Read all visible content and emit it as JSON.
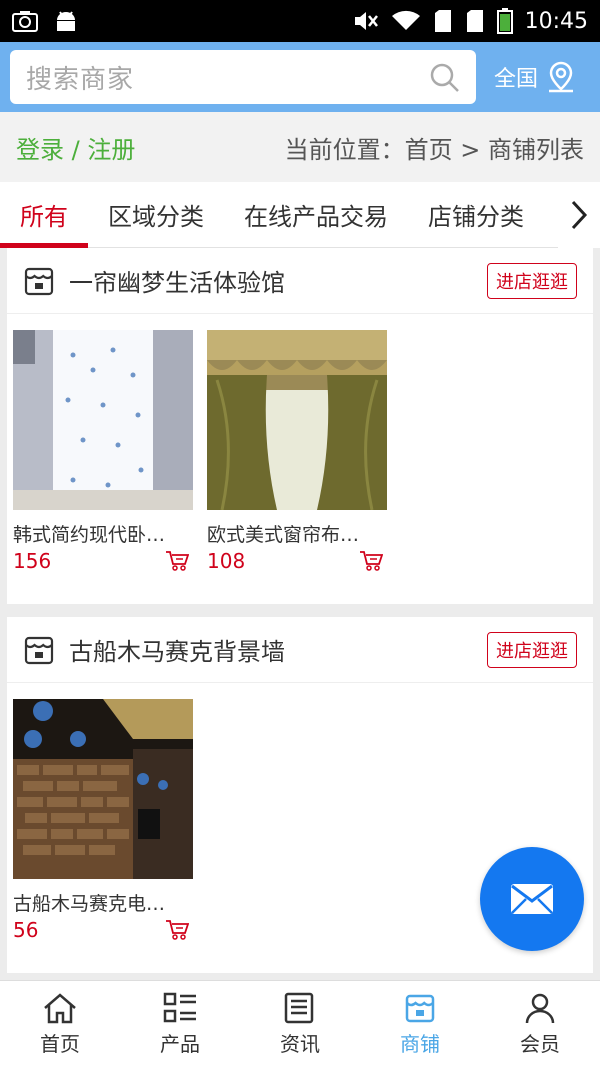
{
  "status_bar": {
    "time": "10:45"
  },
  "search": {
    "placeholder": "搜索商家",
    "region_label": "全国"
  },
  "header": {
    "login_label": "登录 / 注册",
    "breadcrumb": "当前位置：首页 > 商铺列表"
  },
  "tabs": [
    {
      "label": "所有",
      "active": true
    },
    {
      "label": "区域分类",
      "active": false
    },
    {
      "label": "在线产品交易",
      "active": false
    },
    {
      "label": "店铺分类",
      "active": false
    }
  ],
  "shops": [
    {
      "name": "一帘幽梦生活体验馆",
      "visit_label": "进店逛逛",
      "products": [
        {
          "name": "韩式简约现代卧…",
          "price": "156",
          "image": "white curtain with blue pattern"
        },
        {
          "name": "欧式美式窗帘布…",
          "price": "108",
          "image": "gold European curtain"
        }
      ]
    },
    {
      "name": "古船木马赛克背景墙",
      "visit_label": "进店逛逛",
      "products": [
        {
          "name": "古船木马赛克电…",
          "price": "56",
          "image": "wood mosaic wall with lamps"
        }
      ]
    }
  ],
  "bottom_nav": [
    {
      "label": "首页",
      "icon": "home-icon",
      "active": false
    },
    {
      "label": "产品",
      "icon": "grid-list-icon",
      "active": false
    },
    {
      "label": "资讯",
      "icon": "news-icon",
      "active": false
    },
    {
      "label": "商铺",
      "icon": "store-icon",
      "active": true
    },
    {
      "label": "会员",
      "icon": "user-icon",
      "active": false
    }
  ],
  "colors": {
    "accent_red": "#d0021b",
    "header_blue": "#6fb1ef",
    "fab_blue": "#1478f0",
    "login_green": "#4caf3b",
    "nav_active": "#4aa6e6"
  }
}
